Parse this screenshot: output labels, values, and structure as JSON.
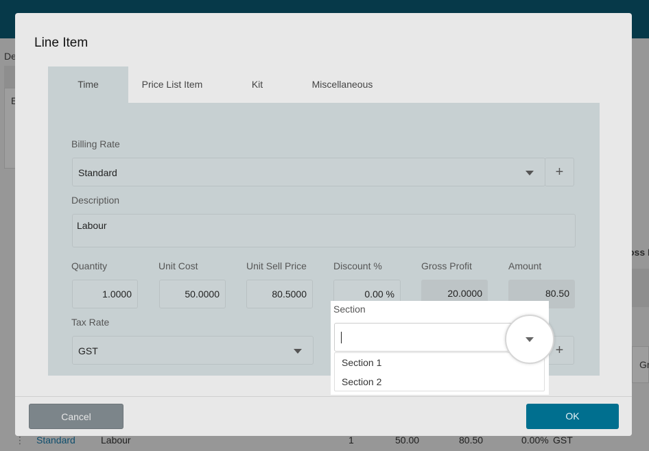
{
  "background": {
    "fragments": {
      "de": "De",
      "e": "E",
      "gross_p": "oss P",
      "gr": "Gr"
    },
    "row": {
      "billing_rate": "Standard",
      "description": "Labour",
      "quantity": "1",
      "unit_cost": "50.00",
      "unit_sell": "80.50",
      "discount": "0.00%",
      "tax": "GST"
    }
  },
  "modal": {
    "title": "Line Item",
    "tabs": [
      {
        "label": "Time",
        "active": true
      },
      {
        "label": "Price List Item"
      },
      {
        "label": "Kit"
      },
      {
        "label": "Miscellaneous"
      }
    ],
    "billing_rate": {
      "label": "Billing Rate",
      "value": "Standard",
      "add_label": "+"
    },
    "description": {
      "label": "Description",
      "value": "Labour"
    },
    "quantity": {
      "label": "Quantity",
      "value": "1.0000"
    },
    "unit_cost": {
      "label": "Unit Cost",
      "value": "50.0000"
    },
    "unit_sell_price": {
      "label": "Unit Sell Price",
      "value": "80.5000"
    },
    "discount": {
      "label": "Discount %",
      "value": "0.00 %"
    },
    "gross_profit": {
      "label": "Gross Profit",
      "value": "20.0000"
    },
    "amount": {
      "label": "Amount",
      "value": "80.50"
    },
    "tax_rate": {
      "label": "Tax Rate",
      "value": "GST"
    },
    "section": {
      "label": "Section",
      "value": "",
      "add_label": "+",
      "options": [
        "Section 1",
        "Section 2"
      ]
    },
    "cancel_label": "Cancel",
    "ok_label": "OK"
  },
  "colors": {
    "topbar": "#0b5c77",
    "ok_button": "#006f8f",
    "cancel_button": "#7c858a",
    "link": "#1a7fb0"
  },
  "icons": [
    "chevron-down-icon",
    "plus-icon",
    "text-cursor-icon"
  ]
}
